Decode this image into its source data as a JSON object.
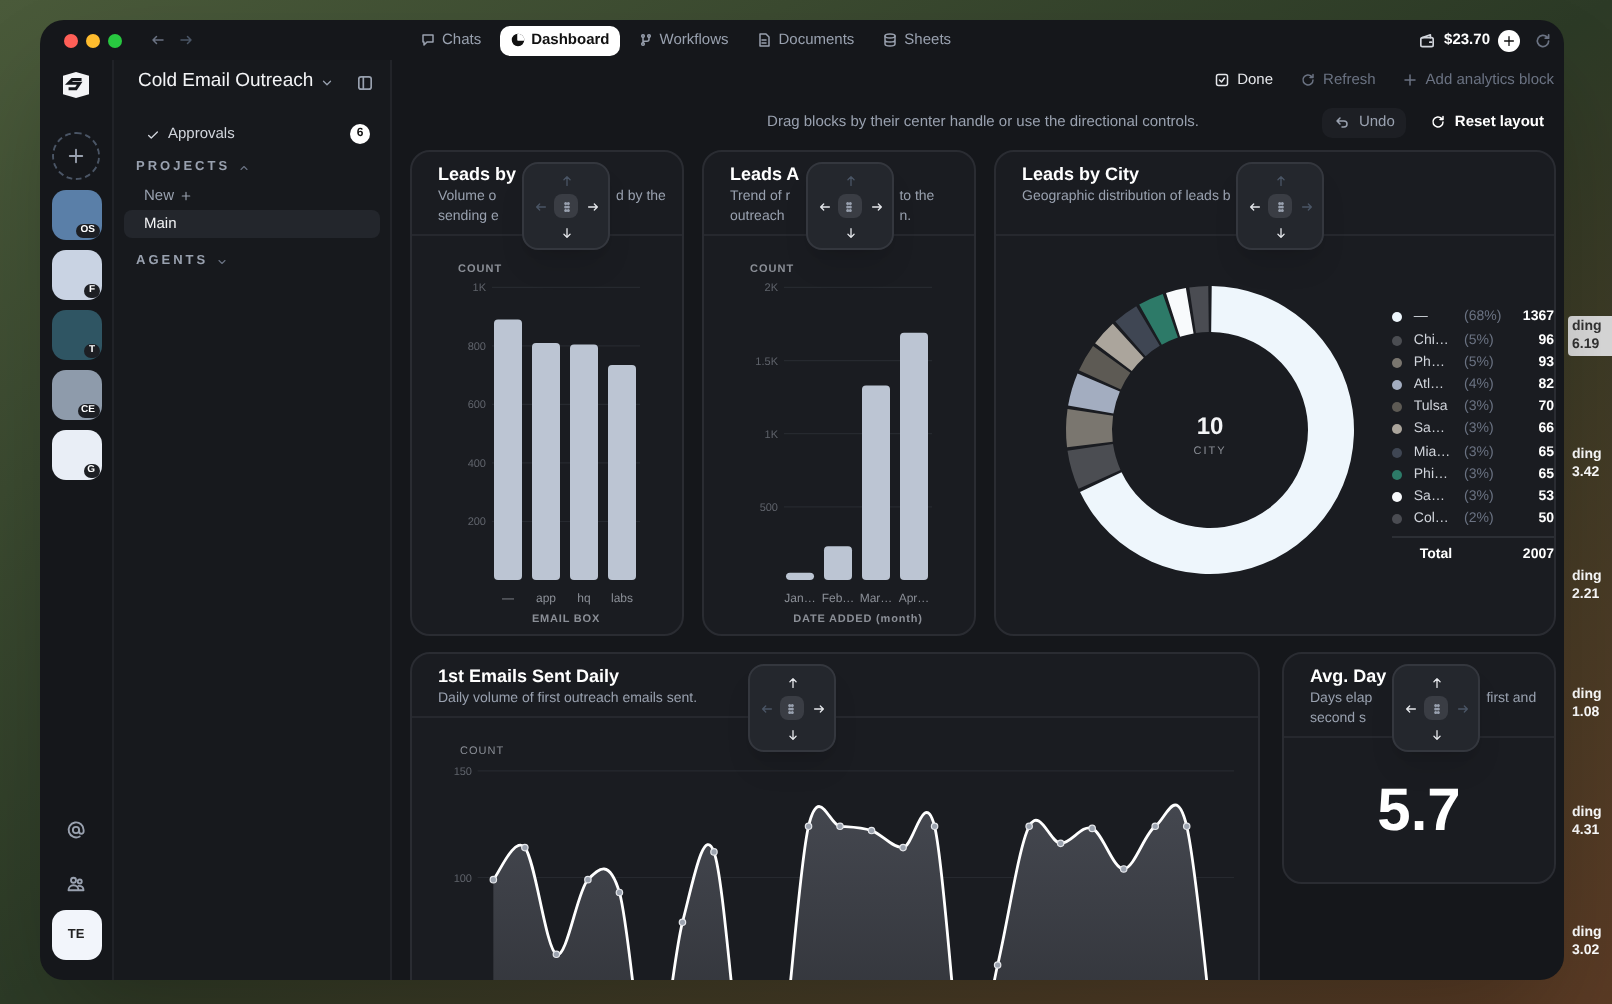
{
  "desktop": {
    "background_labels": [
      {
        "label": "ding",
        "value": "6.19",
        "boxed": true
      },
      {
        "label": "ding",
        "value": "3.42",
        "boxed": false
      },
      {
        "label": "ding",
        "value": "2.21",
        "boxed": false
      },
      {
        "label": "ding",
        "value": "1.08",
        "boxed": false
      },
      {
        "label": "ding",
        "value": "4.31",
        "boxed": false
      },
      {
        "label": "ding",
        "value": "3.02",
        "boxed": false
      }
    ]
  },
  "window": {
    "tabs": [
      {
        "label": "Chats",
        "kind": "chat",
        "selected": false
      },
      {
        "label": "Dashboard",
        "kind": "pie",
        "selected": true
      },
      {
        "label": "Workflows",
        "kind": "workflow",
        "selected": false
      },
      {
        "label": "Documents",
        "kind": "document",
        "selected": false
      },
      {
        "label": "Sheets",
        "kind": "database",
        "selected": false
      }
    ],
    "balance": "$23.70",
    "rail": {
      "apps": [
        {
          "badge": "OS",
          "color": "#5a7fa8"
        },
        {
          "badge": "F",
          "color": "#c9d3e3"
        },
        {
          "badge": "T",
          "color": "#2f5563"
        },
        {
          "badge": "CE",
          "color": "#8e9bab"
        },
        {
          "badge": "G",
          "color": "#e9eef6"
        }
      ],
      "user_initials": "TE"
    },
    "sidebar": {
      "workspace": "Cold Email Outreach",
      "approvals": {
        "label": "Approvals",
        "count": "6"
      },
      "projects": {
        "label": "PROJECTS",
        "expanded": true,
        "new_label": "New",
        "items": [
          {
            "label": "Main",
            "selected": true
          }
        ]
      },
      "agents": {
        "label": "AGENTS",
        "expanded": false
      }
    },
    "toolbar": [
      {
        "label": "Done",
        "kind": "done",
        "disabled": false
      },
      {
        "label": "Refresh",
        "kind": "refresh",
        "disabled": true
      },
      {
        "label": "Add analytics block",
        "kind": "add",
        "disabled": true
      }
    ],
    "hint": "Drag blocks by their center handle or use the directional controls.",
    "layout_actions": [
      {
        "label": "Undo",
        "kind": "undo",
        "disabled": true
      },
      {
        "label": "Reset layout",
        "kind": "reset",
        "disabled": false
      }
    ],
    "blocks": [
      {
        "kind": "chart",
        "title": "Leads by",
        "subtitle_left": [
          "Volume o",
          "sending e"
        ],
        "subtitle_right": [
          "d by the"
        ],
        "controls": {
          "up": false,
          "left": false,
          "right": true,
          "down": true
        },
        "chart_data": {
          "type": "bar",
          "ylabel": "COUNT",
          "xlabel": "EMAIL BOX",
          "categories": [
            "—",
            "app",
            "hq",
            "labs"
          ],
          "values": [
            890,
            810,
            805,
            735
          ],
          "ylim": [
            0,
            1000
          ],
          "grid": true,
          "yticks": [
            {
              "value": 200,
              "label": "200"
            },
            {
              "value": 400,
              "label": "400"
            },
            {
              "value": 600,
              "label": "600"
            },
            {
              "value": 800,
              "label": "800"
            },
            {
              "value": 1000,
              "label": "1K"
            }
          ]
        }
      },
      {
        "kind": "chart",
        "title": "Leads A",
        "subtitle_left": [
          "Trend of r",
          "outreach"
        ],
        "subtitle_right": [
          "to the",
          "n."
        ],
        "controls": {
          "up": false,
          "left": true,
          "right": true,
          "down": true
        },
        "chart_data": {
          "type": "bar",
          "ylabel": "COUNT",
          "xlabel": "DATE ADDED (month)",
          "categories": [
            "Jan…",
            "Feb…",
            "Mar…",
            "Apr…"
          ],
          "values": [
            50,
            230,
            1330,
            1690
          ],
          "ylim": [
            0,
            2000
          ],
          "grid": true,
          "yticks": [
            {
              "value": 500,
              "label": "500"
            },
            {
              "value": 1000,
              "label": "1K"
            },
            {
              "value": 1500,
              "label": "1.5K"
            },
            {
              "value": 2000,
              "label": "2K"
            }
          ]
        }
      },
      {
        "kind": "chart",
        "title": "Leads by City",
        "subtitle_left": [
          "Geographic distribution of leads b"
        ],
        "controls": {
          "up": false,
          "left": true,
          "right": false,
          "down": true
        },
        "center_value": "10",
        "center_label": "CITY",
        "legend": [
          {
            "share": "(68%)",
            "value": "1367",
            "color": "#eef6fc"
          },
          {
            "share": "(5%)",
            "value": "96",
            "color": "#4b4d52"
          },
          {
            "share": "(5%)",
            "value": "93",
            "color": "#7a766f"
          },
          {
            "share": "(4%)",
            "value": "82",
            "color": "#a3adc0"
          },
          {
            "share": "(3%)",
            "value": "70",
            "color": "#5d5a54"
          },
          {
            "share": "(3%)",
            "value": "66",
            "color": "#aba59c"
          },
          {
            "share": "(3%)",
            "value": "65",
            "color": "#3f4653"
          },
          {
            "share": "(3%)",
            "value": "65",
            "color": "#2d7a68"
          },
          {
            "share": "(3%)",
            "value": "53",
            "color": "#f8fafc"
          },
          {
            "share": "(2%)",
            "value": "50",
            "color": "#4a4c52"
          }
        ],
        "total_label": "Total",
        "total_value": "2007",
        "chart_data": {
          "type": "donut",
          "categories": [
            "—",
            "Chi…",
            "Ph…",
            "Atl…",
            "Tulsa",
            "Sa…",
            "Mia…",
            "Phi…",
            "Sa…",
            "Col…"
          ],
          "values": [
            68.11,
            4.78,
            4.63,
            4.09,
            3.49,
            3.29,
            3.24,
            3.24,
            2.64,
            2.49
          ],
          "legend": "right"
        }
      },
      {
        "kind": "chart",
        "title": "1st Emails Sent Daily",
        "subtitle_left": [
          "Daily volume of first outreach emails sent."
        ],
        "controls": {
          "up": true,
          "left": false,
          "right": true,
          "down": true
        },
        "chart_data": {
          "type": "area",
          "ylabel": "COUNT",
          "ylim": [
            0,
            150
          ],
          "grid": true,
          "yticks": [
            100,
            150
          ],
          "values": [
            99,
            114,
            64,
            99,
            93,
            0,
            79,
            112,
            0,
            0,
            124,
            124,
            122,
            114,
            124,
            0,
            59,
            124,
            116,
            123,
            104,
            124,
            124,
            0
          ]
        }
      },
      {
        "kind": "metric",
        "title": "Avg. Day",
        "subtitle_left": [
          "Days elap",
          "second s"
        ],
        "subtitle_right": [
          "first and"
        ],
        "controls": {
          "up": true,
          "left": true,
          "right": false,
          "down": true
        },
        "value": "5.7"
      }
    ]
  }
}
